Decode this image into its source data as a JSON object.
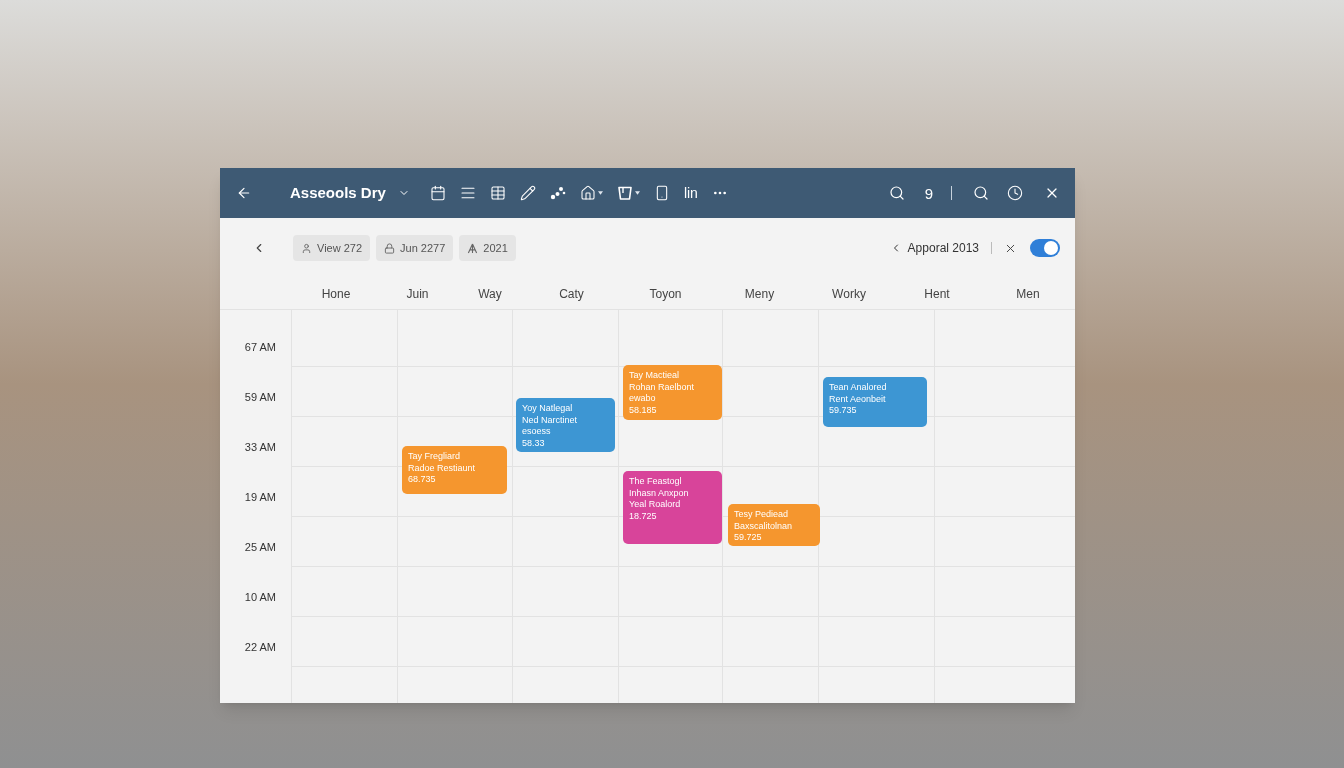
{
  "toolbar": {
    "title": "Asseools Dry",
    "tool_text": "lin",
    "right_text": "9"
  },
  "date_filters": [
    {
      "label": "View 272"
    },
    {
      "label": "Jun 2277"
    },
    {
      "label": "2021"
    }
  ],
  "period": {
    "label": "Apporal 2013"
  },
  "toggle": {
    "on": true
  },
  "columns": [
    "Hone",
    "Juin",
    "Way",
    "Caty",
    "Toyon",
    "Meny",
    "Worky",
    "Hent",
    "Men"
  ],
  "times": [
    "67 AM",
    "59 AM",
    "33 AM",
    "19 AM",
    "25 AM",
    "10 AM",
    "22 AM"
  ],
  "events": [
    {
      "color": "#f5962e",
      "lines": [
        "Tay Fregliard",
        "Radoe Restiaunt",
        "68.735"
      ]
    },
    {
      "color": "#3d96d3",
      "lines": [
        "Yoy Natlegal",
        "Ned Narctinet",
        "esoess",
        "58.33"
      ]
    },
    {
      "color": "#f5962e",
      "lines": [
        "Tay Mactieal",
        "Rohan Raelbont",
        "ewabo",
        "58.185"
      ]
    },
    {
      "color": "#d8449a",
      "lines": [
        "The Feastogl",
        "Inhasn Anxpon",
        "Yeal Roalord",
        "18.725"
      ]
    },
    {
      "color": "#f5962e",
      "lines": [
        "Tesy Pediead",
        "Baxscalitolnan",
        "59.725"
      ]
    },
    {
      "color": "#3d96d3",
      "lines": [
        "Tean Analored",
        "Rent Aeonbeit",
        "59.735"
      ]
    }
  ]
}
